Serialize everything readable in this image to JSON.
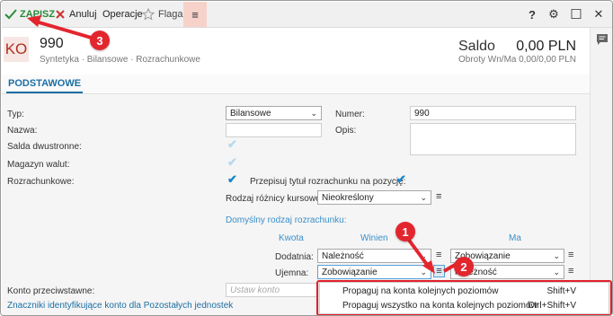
{
  "toolbar": {
    "save_label": "ZAPISZ",
    "cancel_label": "Anuluj",
    "operations_label": "Operacje",
    "flag_label": "Flaga",
    "menu_glyph": "≡",
    "help_glyph": "?",
    "settings_glyph": "⚙",
    "maximize_glyph": "☐",
    "close_glyph": "✕"
  },
  "header": {
    "ko": "KO",
    "account_number": "990",
    "subtitle": "Syntetyka · Bilansowe · Rozrachunkowe",
    "saldo_label": "Saldo",
    "turnover_label": "Obroty Wn/Ma",
    "saldo_value": "0,00 PLN",
    "saldo_sub": "0,00/0,00 PLN"
  },
  "tabs": {
    "active": "PODSTAWOWE"
  },
  "form": {
    "typ_label": "Typ:",
    "typ_value": "Bilansowe",
    "nazwa_label": "Nazwa:",
    "salda_label": "Salda dwustronne:",
    "magazyn_label": "Magazyn walut:",
    "rozrach_label": "Rozrachunkowe:",
    "numer_label": "Numer:",
    "numer_value": "990",
    "opis_label": "Opis:",
    "przepisuj_label": "Przepisuj tytuł rozrachunku na pozycję:",
    "roznica_label": "Rodzaj różnicy kursowej:",
    "roznica_value": "Nieokreślony",
    "default_title": "Domyślny rodzaj rozrachunku:",
    "kwota_label": "Kwota",
    "winien_label": "Winien",
    "ma_label": "Ma",
    "dodatnia_label": "Dodatnia:",
    "dodatnia_winien": "Należność",
    "dodatnia_ma": "Zobowiązanie",
    "ujemna_label": "Ujemna:",
    "ujemna_winien": "Zobowiązanie",
    "ujemna_ma": "Należność",
    "konto_label": "Konto przeciwstawne:",
    "konto_placeholder": "Ustaw konto",
    "znaczniki_link": "Znaczniki identyfikujące konto dla Pozostałych jednostek"
  },
  "context_menu": {
    "items": [
      {
        "label": "Propaguj na konta kolejnych poziomów",
        "shortcut": "Shift+V"
      },
      {
        "label": "Propaguj wszystko na konta kolejnych poziomów",
        "shortcut": "Ctrl+Shift+V"
      }
    ]
  },
  "annotations": {
    "b1": "1",
    "b2": "2",
    "b3": "3"
  },
  "colors": {
    "accent": "#1c6ea4",
    "save": "#2a8a3a",
    "annotation": "#e3262e"
  }
}
